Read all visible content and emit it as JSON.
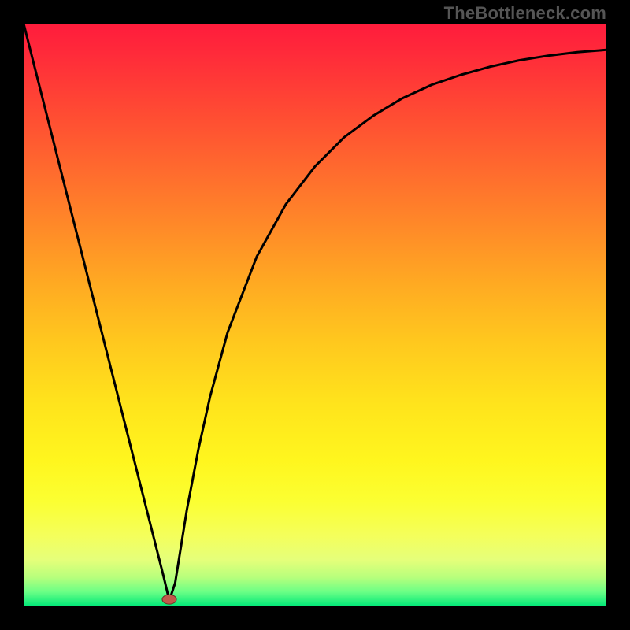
{
  "watermark": "TheBottleneck.com",
  "chart_data": {
    "type": "line",
    "title": "",
    "xlabel": "",
    "ylabel": "",
    "xlim": [
      0,
      100
    ],
    "ylim": [
      0,
      100
    ],
    "x": [
      0,
      2,
      4,
      6,
      8,
      10,
      12,
      14,
      16,
      18,
      20,
      22,
      24,
      25,
      26,
      28,
      30,
      32,
      35,
      40,
      45,
      50,
      55,
      60,
      65,
      70,
      75,
      80,
      85,
      90,
      95,
      100
    ],
    "values": [
      100,
      92.1,
      84.2,
      76.3,
      68.4,
      60.5,
      52.6,
      44.7,
      36.8,
      28.9,
      21.0,
      13.1,
      5.2,
      1.0,
      4.0,
      16.5,
      27.0,
      36.0,
      47.0,
      60.0,
      69.0,
      75.5,
      80.5,
      84.2,
      87.2,
      89.5,
      91.2,
      92.6,
      93.7,
      94.5,
      95.1,
      95.5
    ],
    "marker": {
      "x": 25,
      "y": 1.2
    },
    "gradient_stops": [
      {
        "offset": 0.0,
        "color": "#ff1c3c"
      },
      {
        "offset": 0.05,
        "color": "#ff2a3a"
      },
      {
        "offset": 0.15,
        "color": "#ff4a33"
      },
      {
        "offset": 0.25,
        "color": "#ff6a2e"
      },
      {
        "offset": 0.35,
        "color": "#ff8a28"
      },
      {
        "offset": 0.45,
        "color": "#ffab22"
      },
      {
        "offset": 0.55,
        "color": "#ffc91e"
      },
      {
        "offset": 0.65,
        "color": "#ffe31c"
      },
      {
        "offset": 0.75,
        "color": "#fff61e"
      },
      {
        "offset": 0.82,
        "color": "#fbff32"
      },
      {
        "offset": 0.88,
        "color": "#f4ff5c"
      },
      {
        "offset": 0.92,
        "color": "#e5ff7a"
      },
      {
        "offset": 0.95,
        "color": "#b8ff7c"
      },
      {
        "offset": 0.975,
        "color": "#6bff86"
      },
      {
        "offset": 1.0,
        "color": "#00e878"
      }
    ],
    "marker_style": {
      "fill": "#c05a4a",
      "stroke": "#6a2e24"
    }
  }
}
